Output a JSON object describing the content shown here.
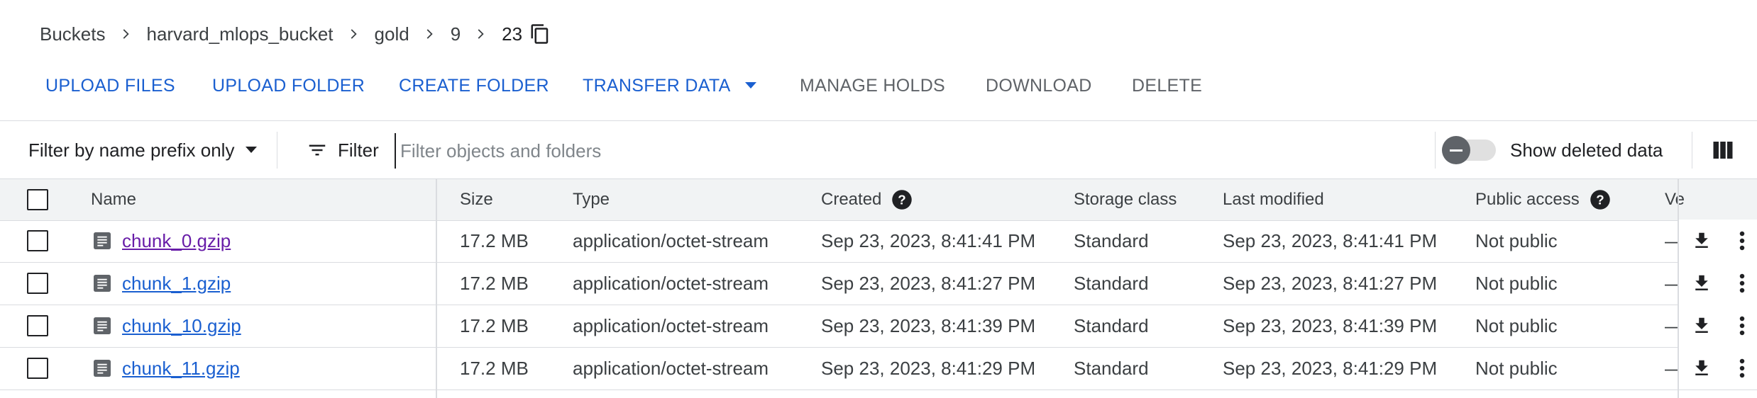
{
  "breadcrumb": {
    "items": [
      "Buckets",
      "harvard_mlops_bucket",
      "gold",
      "9",
      "23"
    ]
  },
  "actions": {
    "upload_files": "UPLOAD FILES",
    "upload_folder": "UPLOAD FOLDER",
    "create_folder": "CREATE FOLDER",
    "transfer_data": "TRANSFER DATA",
    "manage_holds": "MANAGE HOLDS",
    "download": "DOWNLOAD",
    "delete": "DELETE"
  },
  "filter": {
    "prefix_mode": "Filter by name prefix only",
    "filter_label": "Filter",
    "placeholder": "Filter objects and folders",
    "show_deleted_label": "Show deleted data",
    "show_deleted_on": false
  },
  "table": {
    "columns": {
      "name": "Name",
      "size": "Size",
      "type": "Type",
      "created": "Created",
      "storage_class": "Storage class",
      "last_modified": "Last modified",
      "public_access": "Public access",
      "version": "Ve"
    },
    "rows": [
      {
        "name": "chunk_0.gzip",
        "size": "17.2 MB",
        "type": "application/octet-stream",
        "created": "Sep 23, 2023, 8:41:41 PM",
        "storage_class": "Standard",
        "last_modified": "Sep 23, 2023, 8:41:41 PM",
        "public_access": "Not public",
        "version": "—",
        "visited": true
      },
      {
        "name": "chunk_1.gzip",
        "size": "17.2 MB",
        "type": "application/octet-stream",
        "created": "Sep 23, 2023, 8:41:27 PM",
        "storage_class": "Standard",
        "last_modified": "Sep 23, 2023, 8:41:27 PM",
        "public_access": "Not public",
        "version": "—",
        "visited": false
      },
      {
        "name": "chunk_10.gzip",
        "size": "17.2 MB",
        "type": "application/octet-stream",
        "created": "Sep 23, 2023, 8:41:39 PM",
        "storage_class": "Standard",
        "last_modified": "Sep 23, 2023, 8:41:39 PM",
        "public_access": "Not public",
        "version": "—",
        "visited": false
      },
      {
        "name": "chunk_11.gzip",
        "size": "17.2 MB",
        "type": "application/octet-stream",
        "created": "Sep 23, 2023, 8:41:29 PM",
        "storage_class": "Standard",
        "last_modified": "Sep 23, 2023, 8:41:29 PM",
        "public_access": "Not public",
        "version": "—",
        "visited": false
      }
    ]
  },
  "colors": {
    "primary": "#1a5fd0",
    "visited_link": "#681da8",
    "disabled_text": "#5f6368",
    "header_bg": "#f1f3f4",
    "divider": "#dadce0"
  },
  "icons": {
    "breadcrumb_separator": "chevron-right-icon",
    "copy": "copy-icon",
    "dropdown": "arrow-drop-down-icon",
    "filter": "filter-list-icon",
    "column_selector": "view-column-icon",
    "help": "help-icon",
    "file": "file-icon",
    "download": "download-icon",
    "more": "more-vert-icon"
  }
}
